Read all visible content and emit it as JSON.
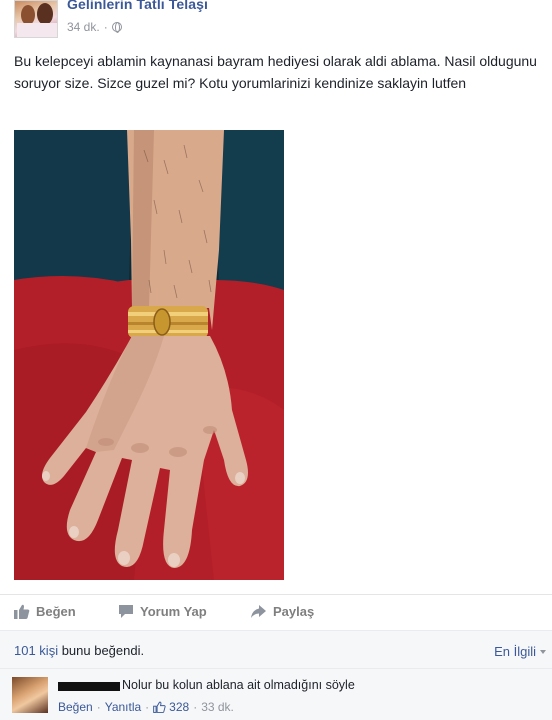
{
  "post": {
    "page_name": "Gelinlerin Tatlı Telaşı",
    "time": "34 dk.",
    "separator": "·",
    "text": "Bu kelepceyi ablamin kaynanasi bayram hediyesi olarak aldi ablama. Nasil oldugunu soruyor size. Sizce guzel mi? Kotu yorumlarinizi kendinize saklayin lutfen",
    "photo_icon": "arm-with-gold-bracelet-photo"
  },
  "actions": {
    "like_label": "Beğen",
    "comment_label": "Yorum Yap",
    "share_label": "Paylaş",
    "like_icon": "thumbs-up-icon",
    "comment_icon": "speech-bubble-icon",
    "share_icon": "share-arrow-icon"
  },
  "likes": {
    "count_text": "101 kişi",
    "rest_text": " bunu beğendi.",
    "sort_label": "En İlgili"
  },
  "comment": {
    "text": "Nolur bu kolun ablana ait olmadığını söyle",
    "like_label": "Beğen",
    "separator": "·",
    "reply_label": "Yanıtla",
    "like_count": "328",
    "time": "33 dk."
  },
  "colors": {
    "link": "#3b5998",
    "muted": "#90949c",
    "photo_background": "#b31f28"
  }
}
